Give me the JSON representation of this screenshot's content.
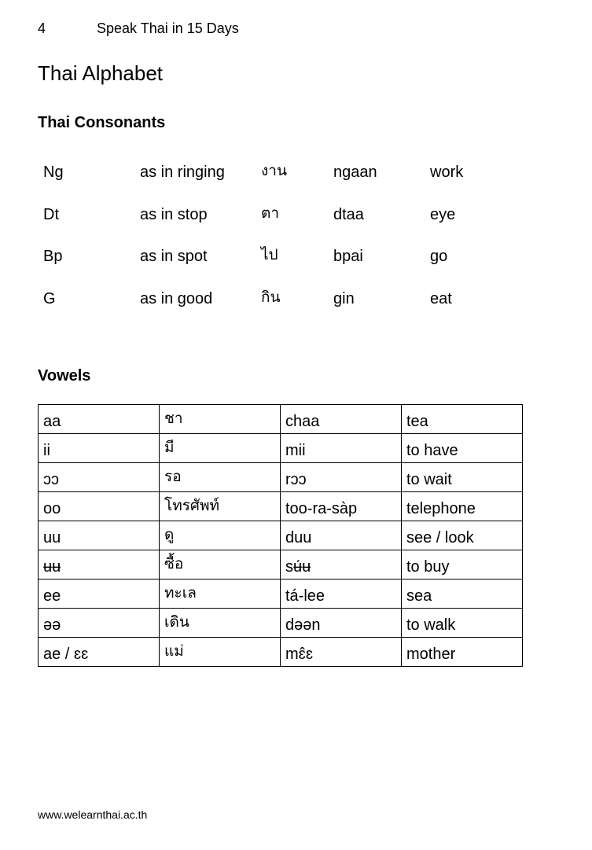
{
  "header": {
    "page_number": "4",
    "book_title": "Speak Thai in 15 Days"
  },
  "title": "Thai Alphabet",
  "consonants": {
    "heading": "Thai Consonants",
    "rows": [
      [
        "Ng",
        "as in ringing",
        "งาน",
        "ngaan",
        "work"
      ],
      [
        "Dt",
        "as in stop",
        "ตา",
        "dtaa",
        "eye"
      ],
      [
        "Bp",
        "as in spot",
        "ไป",
        "bpai",
        "go"
      ],
      [
        "G",
        "as in good",
        "กิน",
        "gin",
        "eat"
      ]
    ]
  },
  "vowels": {
    "heading": "Vowels",
    "rows": [
      [
        "aa",
        "ชา",
        "chaa",
        "tea"
      ],
      [
        "ii",
        "มี",
        "mii",
        "to have"
      ],
      [
        "ɔɔ",
        "รอ",
        "rɔɔ",
        "to wait"
      ],
      [
        "oo",
        "โทรศัพท์",
        "too-ra-sàp",
        "telephone"
      ],
      [
        "uu",
        "ดู",
        "duu",
        "see / look"
      ],
      [
        "ʉʉ",
        "ซื้อ",
        "sʉ́ʉ",
        "to buy"
      ],
      [
        "ee",
        "ทะเล",
        "tá-lee",
        "sea"
      ],
      [
        "əə",
        "เดิน",
        "dəən",
        "to walk"
      ],
      [
        "ae / ɛɛ",
        "แม่",
        "mɛ̂ɛ",
        "mother"
      ]
    ]
  },
  "footer": {
    "url": "www.welearnthai.ac.th"
  }
}
